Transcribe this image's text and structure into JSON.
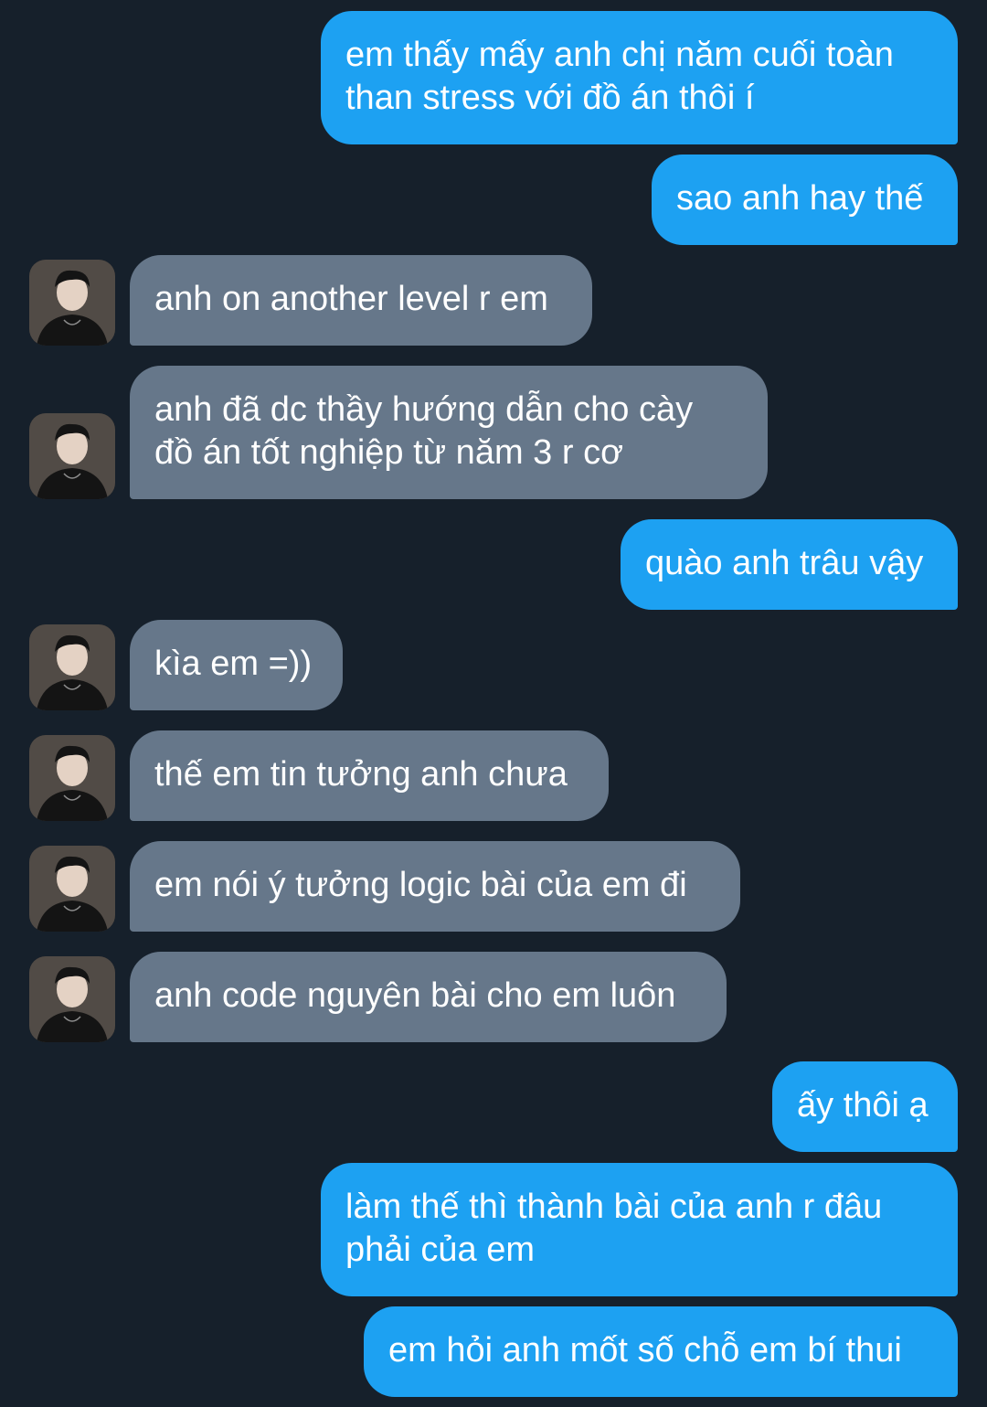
{
  "colors": {
    "background": "#16202b",
    "sent_bubble": "#1da1f2",
    "received_bubble": "#66778a",
    "text": "#ffffff"
  },
  "contact": {
    "avatar": "user-profile-photo-icon"
  },
  "messages": [
    {
      "sender": "me",
      "text": "em thấy mấy anh chị năm cuối toàn\nthan stress với đồ án thôi í"
    },
    {
      "sender": "me",
      "text": "sao anh hay thế"
    },
    {
      "sender": "them",
      "text": "anh on another level r em"
    },
    {
      "sender": "them",
      "text": "anh đã dc thầy hướng dẫn cho cày\nđồ án tốt nghiệp từ năm 3 r cơ"
    },
    {
      "sender": "me",
      "text": "quào anh trâu vậy"
    },
    {
      "sender": "them",
      "text": "kìa em =))"
    },
    {
      "sender": "them",
      "text": "thế em tin tưởng anh chưa"
    },
    {
      "sender": "them",
      "text": "em nói ý tưởng logic bài của em đi"
    },
    {
      "sender": "them",
      "text": "anh code nguyên bài cho em luôn"
    },
    {
      "sender": "me",
      "text": "ấy thôi ạ"
    },
    {
      "sender": "me",
      "text": "làm thế thì thành bài của anh r đâu\nphải của em"
    },
    {
      "sender": "me",
      "text": "em hỏi anh mốt số chỗ em bí thui"
    }
  ]
}
